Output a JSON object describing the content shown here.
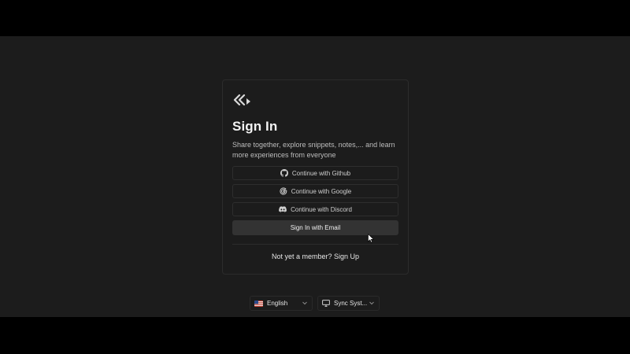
{
  "signin": {
    "title": "Sign In",
    "subtitle": "Share together, explore snippets, notes,... and learn more experiences from everyone",
    "buttons": {
      "github": "Continue with Github",
      "google": "Continue with Google",
      "discord": "Continue with Discord",
      "email": "Sign In with Email"
    },
    "signup_prompt": "Not yet a member?",
    "signup_link": "Sign Up"
  },
  "footer": {
    "language": "English",
    "theme": "Sync Syst..."
  },
  "icons": {
    "logo": "chevrons-logo-icon",
    "github": "github-icon",
    "google": "google-icon",
    "discord": "discord-icon",
    "flag": "us-flag-icon",
    "monitor": "monitor-icon",
    "chevron": "chevron-down-icon",
    "cursor": "mouse-cursor-icon"
  },
  "colors": {
    "background": "#1c1c1c",
    "card_border": "#2c2c2c",
    "primary_button": "#333333",
    "text": "#e8e8e8"
  }
}
